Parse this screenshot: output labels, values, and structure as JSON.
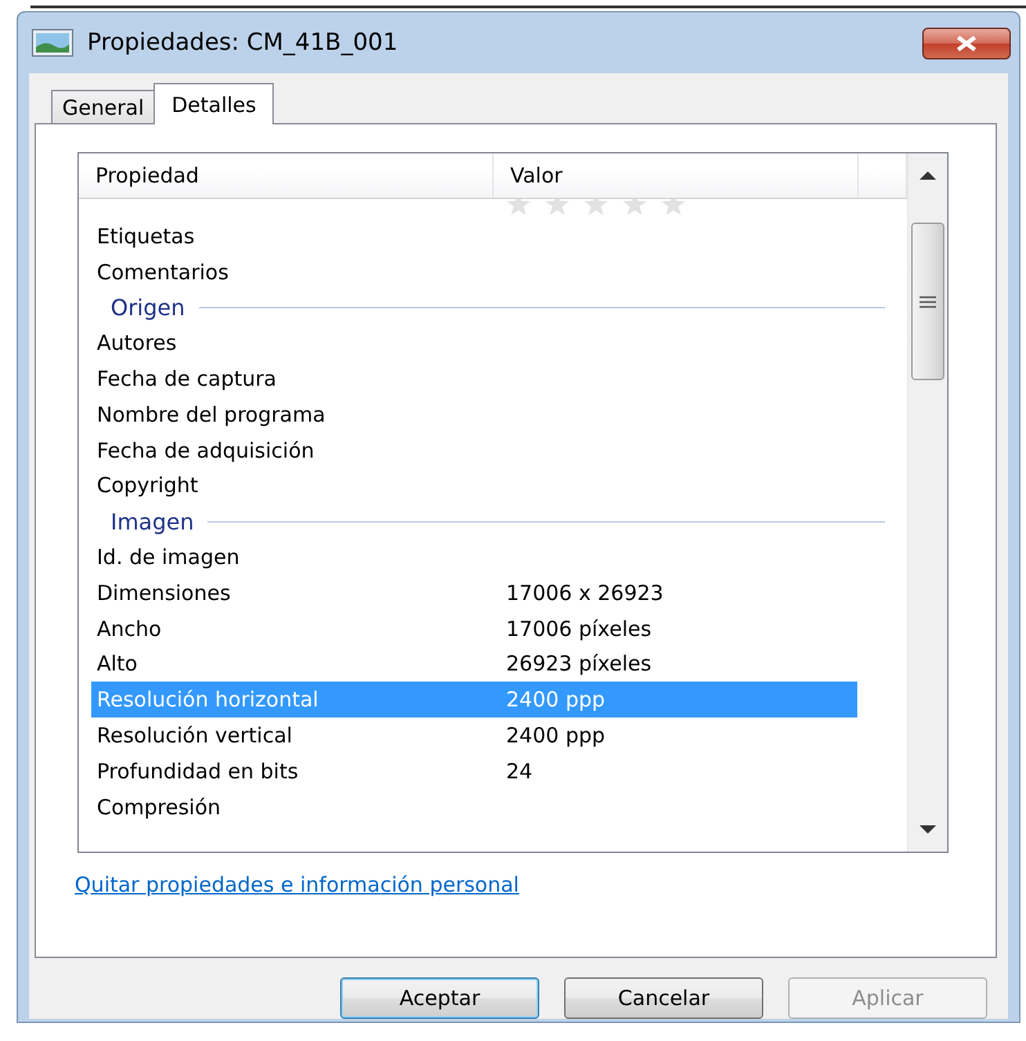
{
  "window": {
    "title": "Propiedades: CM_41B_001"
  },
  "tabs": [
    {
      "label": "General",
      "selected": false
    },
    {
      "label": "Detalles",
      "selected": true
    }
  ],
  "table": {
    "columns": [
      "Propiedad",
      "Valor"
    ],
    "rows": [
      {
        "kind": "rating",
        "stars": 0,
        "selected": false
      },
      {
        "kind": "property",
        "label": "Etiquetas",
        "selected": false
      },
      {
        "kind": "property",
        "label": "Comentarios",
        "selected": false
      },
      {
        "kind": "group",
        "label": "Origen"
      },
      {
        "kind": "property",
        "label": "Autores",
        "selected": false
      },
      {
        "kind": "property",
        "label": "Fecha de captura",
        "selected": false
      },
      {
        "kind": "property",
        "label": "Nombre del programa",
        "selected": false
      },
      {
        "kind": "property",
        "label": "Fecha de adquisición",
        "selected": false
      },
      {
        "kind": "property",
        "label": "Copyright",
        "selected": false
      },
      {
        "kind": "group",
        "label": "Imagen"
      },
      {
        "kind": "property",
        "label": "Id. de imagen",
        "selected": false
      },
      {
        "kind": "property",
        "label": "Dimensiones",
        "value": "17006 x 26923",
        "selected": false
      },
      {
        "kind": "property",
        "label": "Ancho",
        "value": "17006 píxeles",
        "selected": false
      },
      {
        "kind": "property",
        "label": "Alto",
        "value": "26923 píxeles",
        "selected": false
      },
      {
        "kind": "property",
        "label": "Resolución horizontal",
        "value": "2400 ppp",
        "selected": true
      },
      {
        "kind": "property",
        "label": "Resolución vertical",
        "value": "2400 ppp",
        "selected": false
      },
      {
        "kind": "property",
        "label": "Profundidad en bits",
        "value": "24",
        "selected": false
      },
      {
        "kind": "property",
        "label": "Compresión",
        "selected": false
      }
    ]
  },
  "link": "Quitar propiedades e información personal",
  "buttons": [
    {
      "label": "Aceptar",
      "kind": "default",
      "disabled": false
    },
    {
      "label": "Cancelar",
      "kind": "normal",
      "disabled": false
    },
    {
      "label": "Aplicar",
      "kind": "normal",
      "disabled": true
    }
  ]
}
